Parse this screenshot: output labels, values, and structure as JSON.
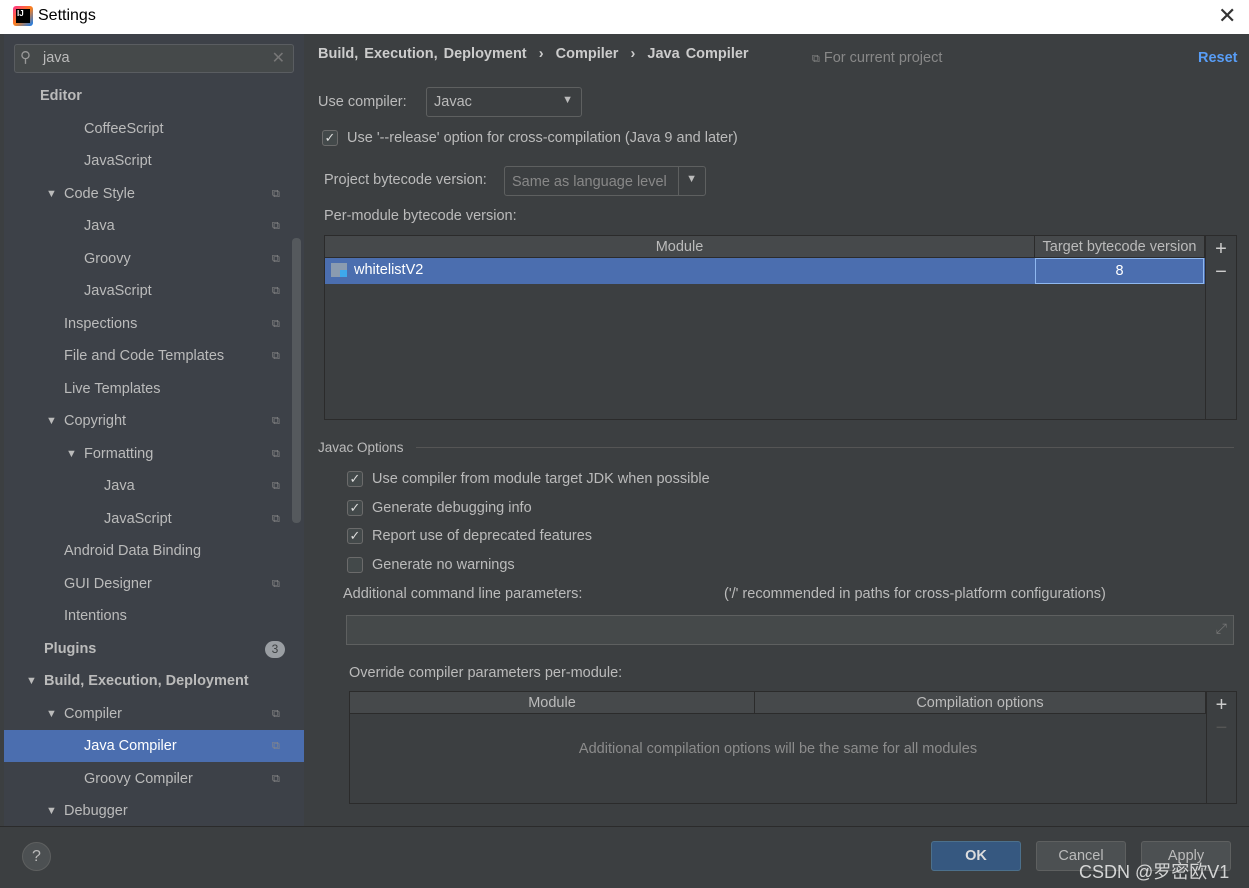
{
  "window": {
    "title": "Settings",
    "close_icon": "close-icon"
  },
  "search": {
    "value": "java",
    "icon": "search-icon"
  },
  "sidebar": {
    "items": [
      {
        "label": "Editor",
        "level": 0,
        "bold": true
      },
      {
        "label": "CoffeeScript",
        "level": 2
      },
      {
        "label": "JavaScript",
        "level": 2
      },
      {
        "label": "Code Style",
        "level": 1,
        "expanded": true,
        "project": true
      },
      {
        "label": "Java",
        "level": 2,
        "project": true
      },
      {
        "label": "Groovy",
        "level": 2,
        "project": true
      },
      {
        "label": "JavaScript",
        "level": 2,
        "project": true
      },
      {
        "label": "Inspections",
        "level": 1,
        "project": true
      },
      {
        "label": "File and Code Templates",
        "level": 1,
        "project": true
      },
      {
        "label": "Live Templates",
        "level": 1
      },
      {
        "label": "Copyright",
        "level": 1,
        "expanded": true,
        "project": true
      },
      {
        "label": "Formatting",
        "level": 2,
        "expanded": true,
        "project": true
      },
      {
        "label": "Java",
        "level": 3,
        "project": true
      },
      {
        "label": "JavaScript",
        "level": 3,
        "project": true
      },
      {
        "label": "Android Data Binding",
        "level": 1
      },
      {
        "label": "GUI Designer",
        "level": 1,
        "project": true
      },
      {
        "label": "Intentions",
        "level": 1
      },
      {
        "label": "Plugins",
        "level": 0,
        "bold": true,
        "badge": "3"
      },
      {
        "label": "Build, Execution, Deployment",
        "level": 0,
        "bold": true,
        "expanded": true
      },
      {
        "label": "Compiler",
        "level": 1,
        "expanded": true,
        "project": true
      },
      {
        "label": "Java Compiler",
        "level": 2,
        "project": true,
        "selected": true
      },
      {
        "label": "Groovy Compiler",
        "level": 2,
        "project": true
      },
      {
        "label": "Debugger",
        "level": 1,
        "expanded": true
      }
    ]
  },
  "breadcrumb": [
    "Build, Execution, Deployment",
    "Compiler",
    "Java Compiler"
  ],
  "breadcrumb_sep": "›",
  "for_current_project": "For current project",
  "reset": "Reset",
  "use_compiler": {
    "label": "Use compiler:",
    "value": "Javac"
  },
  "release_option": {
    "label": "Use '--release' option for cross-compilation (Java 9 and later)",
    "checked": true
  },
  "project_bytecode": {
    "label": "Project bytecode version:",
    "value": "Same as language level"
  },
  "per_module": {
    "label": "Per-module bytecode version:",
    "columns": [
      "Module",
      "Target bytecode version"
    ],
    "rows": [
      {
        "module": "whitelistV2",
        "version": "8"
      }
    ]
  },
  "javac_options": {
    "title": "Javac Options",
    "checks": [
      {
        "label": "Use compiler from module target JDK when possible",
        "checked": true
      },
      {
        "label": "Generate debugging info",
        "checked": true
      },
      {
        "label": "Report use of deprecated features",
        "checked": true
      },
      {
        "label": "Generate no warnings",
        "checked": false
      }
    ],
    "additional_label": "Additional command line parameters:",
    "additional_hint": "('/' recommended in paths for cross-platform configurations)",
    "additional_value": "",
    "override_label": "Override compiler parameters per-module:",
    "override_columns": [
      "Module",
      "Compilation options"
    ],
    "override_empty": "Additional compilation options will be the same for all modules"
  },
  "table_buttons": {
    "add": "+",
    "remove": "−"
  },
  "footer": {
    "help": "?",
    "ok": "OK",
    "cancel": "Cancel",
    "apply": "Apply"
  },
  "watermark": "CSDN @罗密欧V1",
  "colors": {
    "selection": "#4b6eaf",
    "link": "#589df6",
    "ok_button": "#365880"
  }
}
